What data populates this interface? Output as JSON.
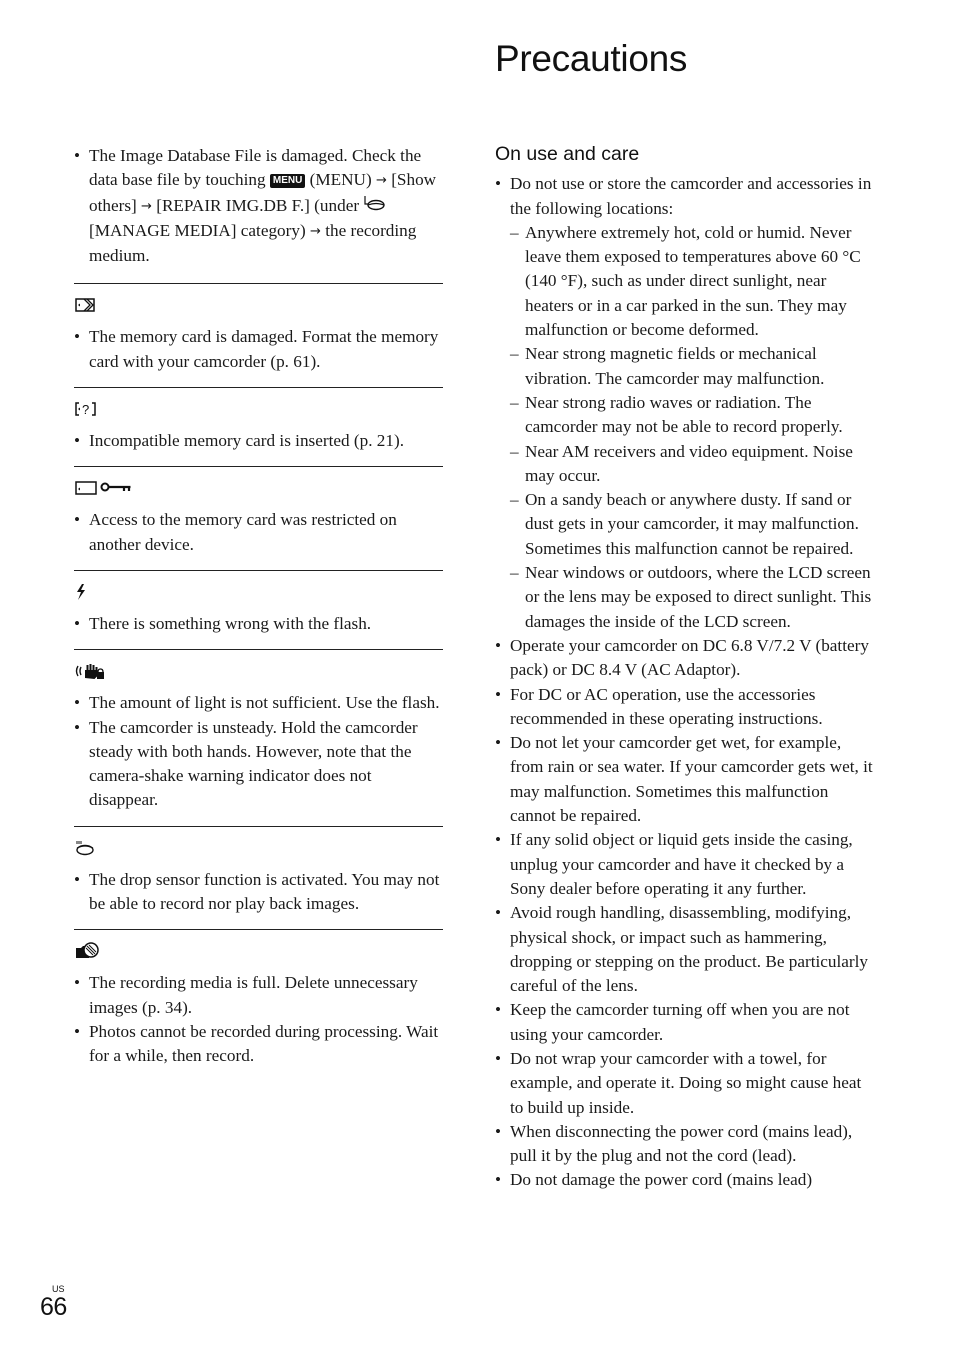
{
  "header": {
    "title": "Precautions"
  },
  "left": {
    "intro": {
      "parts": {
        "a": "The Image Database File is damaged. Check the data base file by touching ",
        "menu_key": "MENU",
        "b": " (MENU) ",
        "c": " [Show others] ",
        "d": " [REPAIR IMG.DB F.] (under ",
        "e": " [MANAGE MEDIA] category) ",
        "f": " the recording medium."
      },
      "arrow": "→"
    },
    "sections": [
      {
        "icon": "memory-card-damaged-icon",
        "items": [
          "The memory card is damaged. Format the memory card with your camcorder (p. 61)."
        ]
      },
      {
        "icon": "incompatible-card-icon",
        "items": [
          "Incompatible memory card is inserted (p. 21)."
        ]
      },
      {
        "icon": "card-locked-key-icon",
        "items": [
          "Access to the memory card was restricted on another device."
        ]
      },
      {
        "icon": "flash-warning-icon",
        "items": [
          "There is something wrong with the flash."
        ]
      },
      {
        "icon": "camera-shake-icon",
        "items": [
          "The amount of light is not sufficient. Use the flash.",
          "The camcorder is unsteady. Hold the camcorder steady with both hands. However, note that the camera-shake warning indicator does not disappear."
        ]
      },
      {
        "icon": "drop-sensor-icon",
        "items": [
          "The drop sensor function is activated. You may not be able to record nor play back images."
        ]
      },
      {
        "icon": "media-full-icon",
        "items": [
          "The recording media is full. Delete unnecessary images (p. 34).",
          "Photos cannot be recorded during processing. Wait for a while, then record."
        ]
      }
    ]
  },
  "right": {
    "subheading": "On use and care",
    "items": [
      {
        "text": "Do not use or store the camcorder and accessories in the following locations:",
        "sub": [
          "Anywhere extremely hot, cold or humid. Never leave them exposed to temperatures above 60 °C (140 °F), such as under direct sunlight, near heaters or in a car parked in the sun. They may malfunction or become deformed.",
          "Near strong magnetic fields or mechanical vibration. The camcorder may malfunction.",
          "Near strong radio waves or radiation. The camcorder may not be able to record properly.",
          "Near AM receivers and video equipment. Noise may occur.",
          "On a sandy beach or anywhere dusty. If sand or dust gets in your camcorder, it may malfunction. Sometimes this malfunction cannot be repaired.",
          "Near windows or outdoors, where the LCD screen or the lens may be exposed to direct sunlight. This damages the inside of the LCD screen."
        ]
      },
      {
        "text": "Operate your camcorder on DC 6.8 V/7.2 V (battery pack) or DC 8.4 V (AC Adaptor)."
      },
      {
        "text": "For DC or AC operation, use the accessories recommended in these operating instructions."
      },
      {
        "text": "Do not let your camcorder get wet, for example, from rain or sea water. If your camcorder gets wet, it may malfunction. Sometimes this malfunction cannot be repaired."
      },
      {
        "text": "If any solid object or liquid gets inside the casing, unplug your camcorder and have it checked by a Sony dealer before operating it any further."
      },
      {
        "text": "Avoid rough handling, disassembling, modifying, physical shock, or impact such as hammering, dropping or stepping on the product. Be particularly careful of the lens."
      },
      {
        "text": "Keep the camcorder turning off when you are not using your camcorder."
      },
      {
        "text": "Do not wrap your camcorder with a towel, for example, and operate it. Doing so might cause heat to build up inside."
      },
      {
        "text": "When disconnecting the power cord (mains lead), pull it by the plug and not the cord (lead)."
      },
      {
        "text": "Do not damage the power cord (mains lead)"
      }
    ]
  },
  "footer": {
    "region": "US",
    "page_number": "66"
  }
}
